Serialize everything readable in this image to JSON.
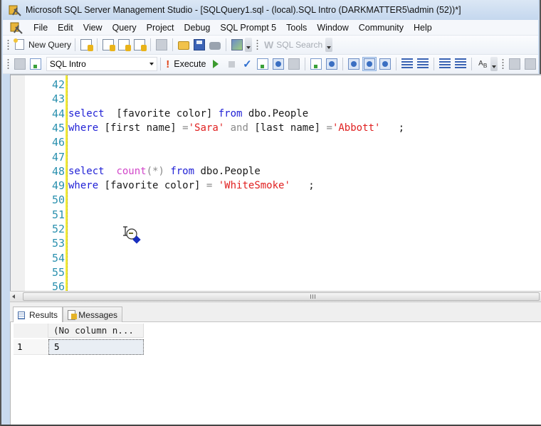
{
  "window": {
    "title": "Microsoft SQL Server Management Studio - [SQLQuery1.sql - (local).SQL Intro (DARKMATTER5\\admin (52))*]"
  },
  "menubar": {
    "items": [
      "File",
      "Edit",
      "View",
      "Query",
      "Project",
      "Debug",
      "SQL Prompt 5",
      "Tools",
      "Window",
      "Community",
      "Help"
    ]
  },
  "toolbar1": {
    "new_query_label": "New Query",
    "sql_search_label": "SQL Search",
    "icons": [
      "new-database-query-icon",
      "mdx-query-icon",
      "dmx-query-icon",
      "xmla-query-icon",
      "new-file-icon",
      "open-file-icon",
      "save-icon",
      "print-icon",
      "activity-monitor-icon"
    ]
  },
  "toolbar2": {
    "database_selected": "SQL Intro",
    "execute_label": "Execute",
    "icons": [
      "connect-icon",
      "change-connection-icon",
      "debug-icon",
      "cancel-icon",
      "parse-icon",
      "display-plan-icon",
      "query-designer-icon",
      "specify-values-icon",
      "include-plan-icon",
      "client-stats-icon",
      "results-to-text-icon",
      "results-to-grid-icon",
      "results-to-file-icon",
      "comment-icon",
      "uncomment-icon",
      "decrease-indent-icon",
      "increase-indent-icon",
      "format-icon"
    ]
  },
  "editor": {
    "lines": [
      {
        "num": "42",
        "tokens": []
      },
      {
        "num": "43",
        "tokens": []
      },
      {
        "num": "44",
        "tokens": [
          {
            "t": "select",
            "c": "kw"
          },
          {
            "t": "  [favorite color] ",
            "c": "idn"
          },
          {
            "t": "from",
            "c": "kw"
          },
          {
            "t": " dbo.People",
            "c": "idn"
          }
        ]
      },
      {
        "num": "45",
        "tokens": [
          {
            "t": "where",
            "c": "kw"
          },
          {
            "t": " [first name] ",
            "c": "idn"
          },
          {
            "t": "=",
            "c": "op"
          },
          {
            "t": "'Sara'",
            "c": "str"
          },
          {
            "t": " and ",
            "c": "op"
          },
          {
            "t": "[last name] ",
            "c": "idn"
          },
          {
            "t": "=",
            "c": "op"
          },
          {
            "t": "'Abbott'",
            "c": "str"
          },
          {
            "t": "   ;",
            "c": "idn"
          }
        ]
      },
      {
        "num": "46",
        "tokens": []
      },
      {
        "num": "47",
        "tokens": []
      },
      {
        "num": "48",
        "tokens": [
          {
            "t": "select",
            "c": "kw"
          },
          {
            "t": "  ",
            "c": "idn"
          },
          {
            "t": "count",
            "c": "fn"
          },
          {
            "t": "(*)",
            "c": "op"
          },
          {
            "t": " ",
            "c": "idn"
          },
          {
            "t": "from",
            "c": "kw"
          },
          {
            "t": " dbo.People",
            "c": "idn"
          }
        ]
      },
      {
        "num": "49",
        "tokens": [
          {
            "t": "where",
            "c": "kw"
          },
          {
            "t": " [favorite color] ",
            "c": "idn"
          },
          {
            "t": "=",
            "c": "op"
          },
          {
            "t": " ",
            "c": "idn"
          },
          {
            "t": "'WhiteSmoke'",
            "c": "str"
          },
          {
            "t": "   ;",
            "c": "idn"
          }
        ]
      },
      {
        "num": "50",
        "tokens": []
      },
      {
        "num": "51",
        "tokens": []
      },
      {
        "num": "52",
        "tokens": []
      },
      {
        "num": "53",
        "tokens": []
      },
      {
        "num": "54",
        "tokens": []
      },
      {
        "num": "55",
        "tokens": []
      },
      {
        "num": "56",
        "tokens": []
      }
    ]
  },
  "results": {
    "tabs": [
      {
        "label": "Results",
        "active": true
      },
      {
        "label": "Messages",
        "active": false
      }
    ],
    "columns": [
      "(No column n..."
    ],
    "rows": [
      {
        "num": "1",
        "cells": [
          "5"
        ]
      }
    ]
  }
}
